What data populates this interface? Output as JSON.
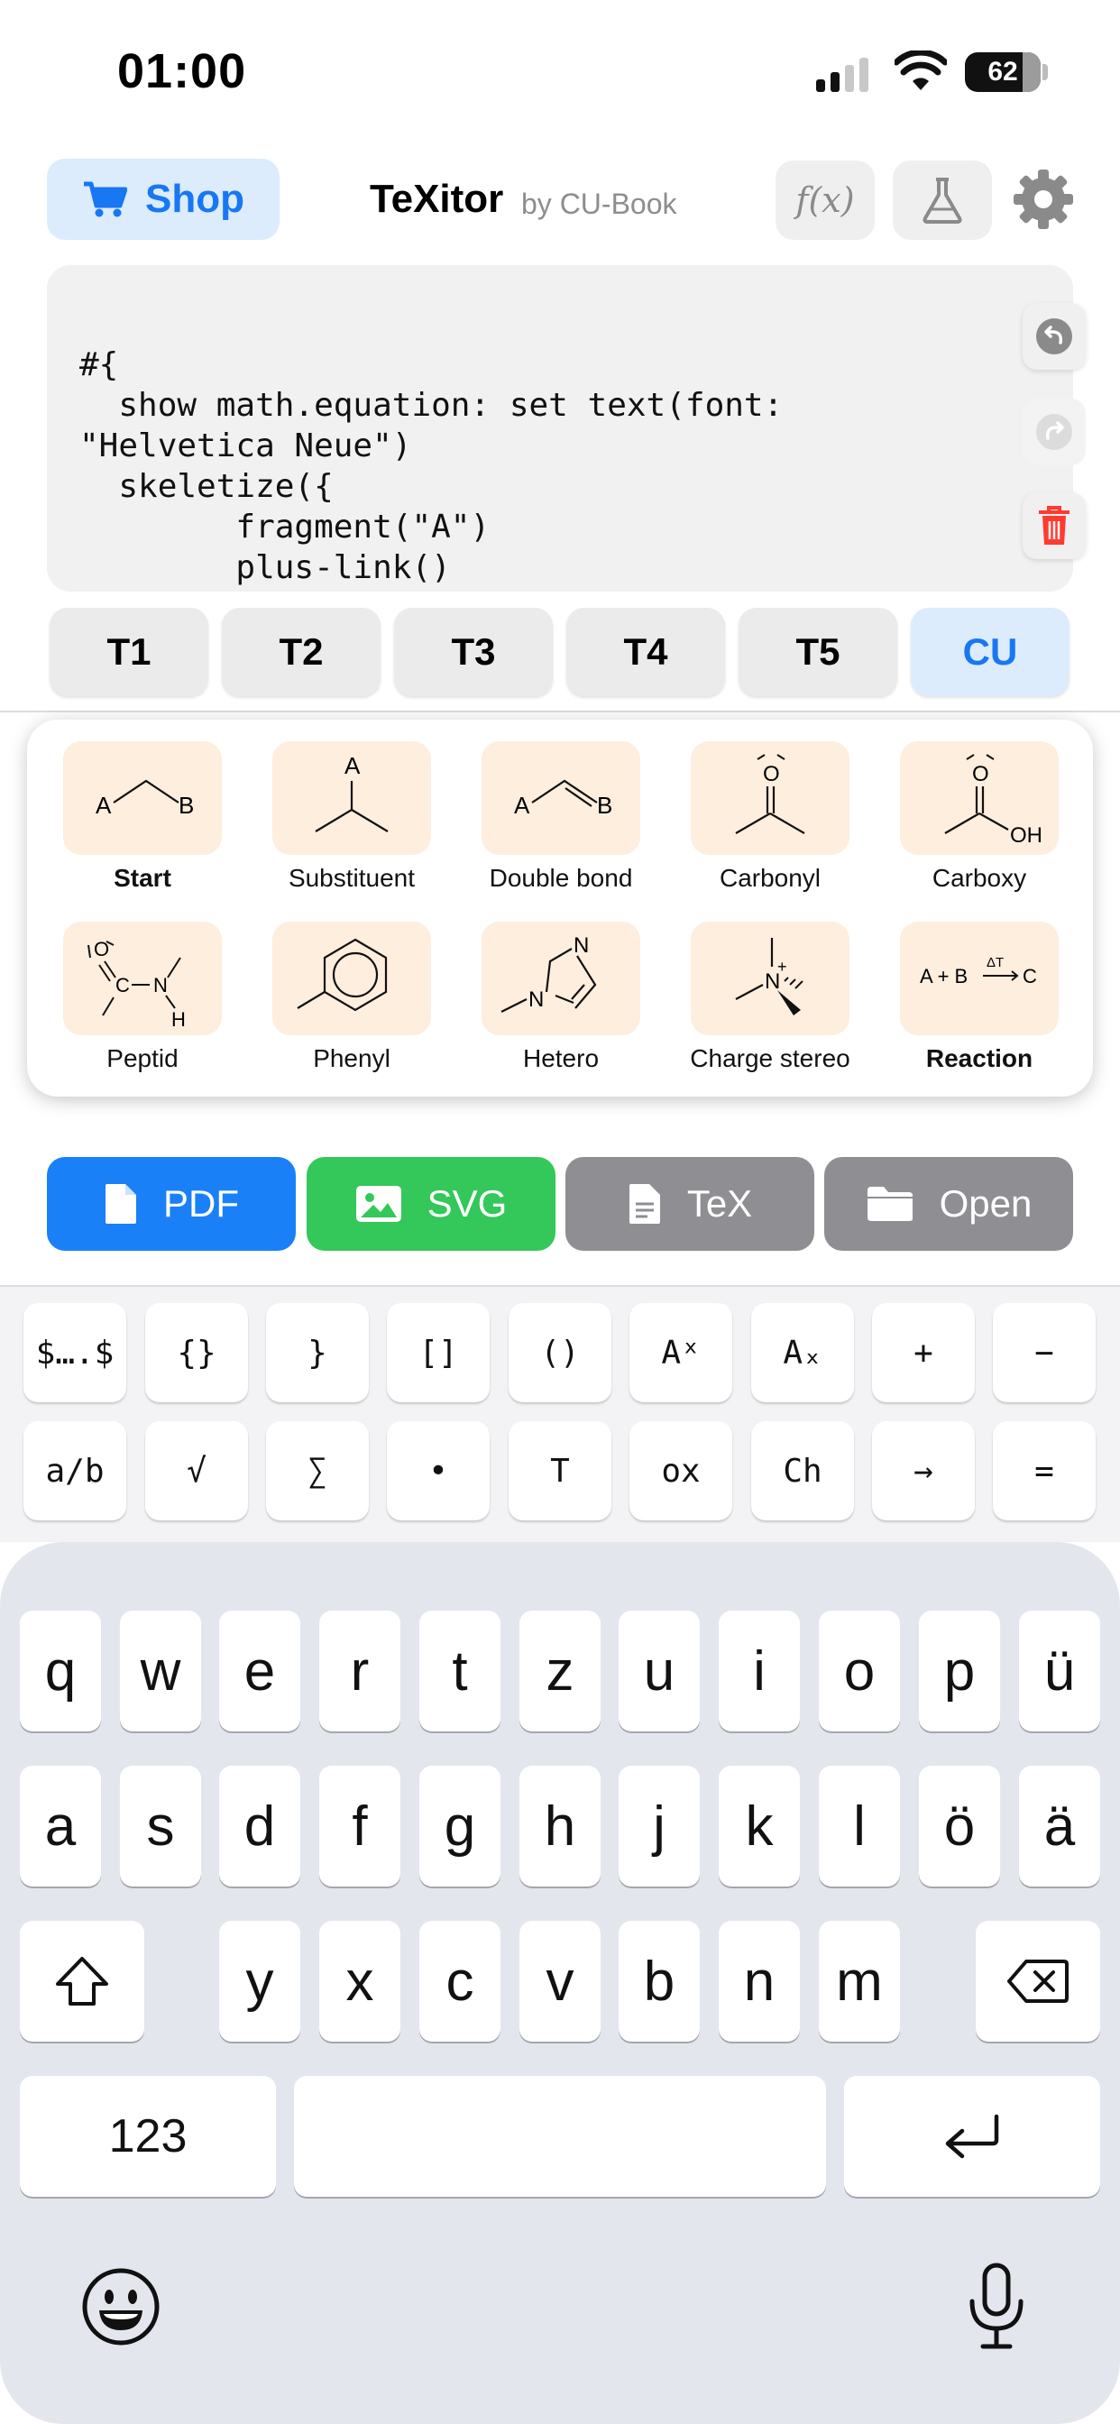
{
  "status_bar": {
    "time": "01:00",
    "battery": "62"
  },
  "header": {
    "shop_label": "Shop",
    "app_title": "TeXitor",
    "app_subtitle": "by CU-Book",
    "function_button_label": "f(x)"
  },
  "editor": {
    "lines": [
      "#{",
      "  show math.equation: set text(font:",
      "\"Helvetica Neue\")",
      "  skeletize({",
      "        fragment(\"A\")",
      "        plus-link()"
    ]
  },
  "templates": {
    "tabs": [
      "T1",
      "T2",
      "T3",
      "T4",
      "T5",
      "CU"
    ],
    "active_tab": "CU"
  },
  "snippets": {
    "items": [
      {
        "label": "Start",
        "bold": true,
        "icon": "start-chain-icon"
      },
      {
        "label": "Substituent",
        "bold": false,
        "icon": "substituent-icon"
      },
      {
        "label": "Double bond",
        "bold": false,
        "icon": "double-bond-icon"
      },
      {
        "label": "Carbonyl",
        "bold": false,
        "icon": "carbonyl-icon"
      },
      {
        "label": "Carboxy",
        "bold": false,
        "icon": "carboxy-icon"
      },
      {
        "label": "Peptid",
        "bold": false,
        "icon": "peptide-icon"
      },
      {
        "label": "Phenyl",
        "bold": false,
        "icon": "phenyl-ring-icon"
      },
      {
        "label": "Hetero",
        "bold": false,
        "icon": "imidazole-icon"
      },
      {
        "label": "Charge stereo",
        "bold": false,
        "icon": "charged-nitrogen-icon"
      },
      {
        "label": "Reaction",
        "bold": true,
        "icon": "reaction-arrow-icon"
      }
    ],
    "structure_text": {
      "a": "A",
      "b": "B",
      "o": "O",
      "oh": "OH",
      "n": "N",
      "h": "H",
      "c": "C",
      "reaction": "A + B",
      "reaction_c": "C",
      "delta_t": "ΔT",
      "n_plus": "N+"
    }
  },
  "export": {
    "pdf": "PDF",
    "svg": "SVG",
    "tex": "TeX",
    "open": "Open"
  },
  "symbol_keys": {
    "row1": [
      "$….$",
      "{}",
      "}",
      "[]",
      "()",
      "Aˣ",
      "Aₓ",
      "+",
      "−"
    ],
    "row2": [
      "a/b",
      "√",
      "∑",
      "•",
      "T",
      "ox",
      "Ch",
      "→",
      "="
    ]
  },
  "keyboard": {
    "row1": [
      "q",
      "w",
      "e",
      "r",
      "t",
      "z",
      "u",
      "i",
      "o",
      "p",
      "ü"
    ],
    "row2": [
      "a",
      "s",
      "d",
      "f",
      "g",
      "h",
      "j",
      "k",
      "l",
      "ö",
      "ä"
    ],
    "row3": [
      "y",
      "x",
      "c",
      "v",
      "b",
      "n",
      "m"
    ],
    "numbers_key": "123"
  },
  "colors": {
    "accent_blue": "#1877f2",
    "shop_bg": "#dcecfc",
    "pdf_bg": "#1a80f8",
    "svg_bg": "#34c759",
    "tex_bg": "#8e8e93",
    "open_bg": "#8e8e93",
    "tile_bg": "#fdeede",
    "trash_red": "#ff3b30"
  }
}
